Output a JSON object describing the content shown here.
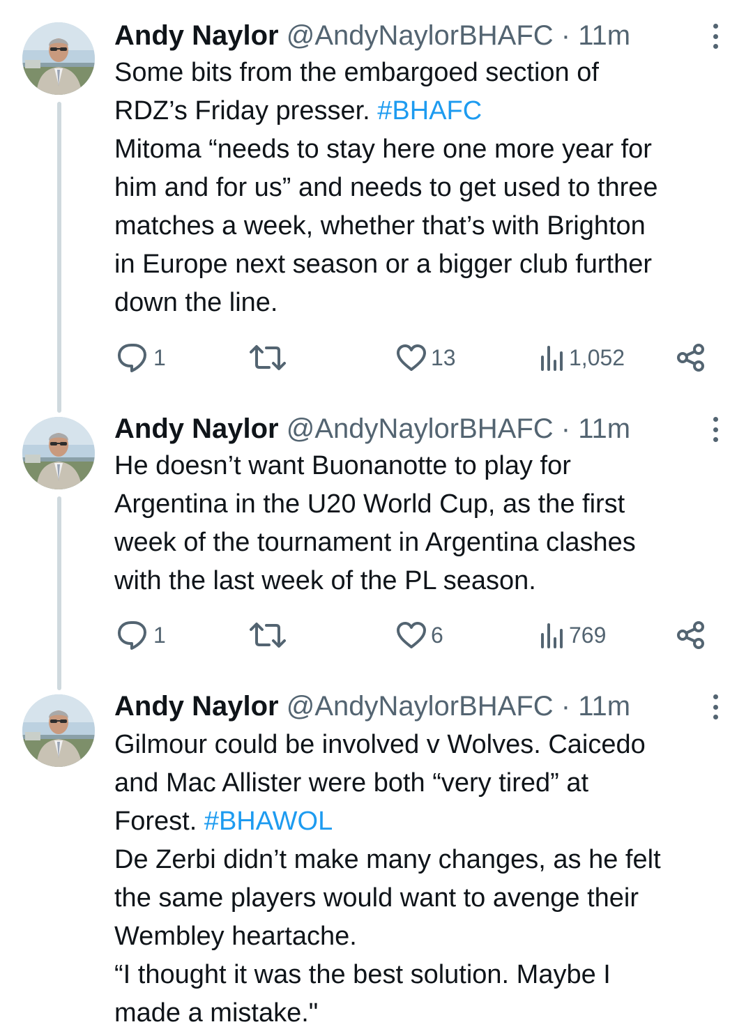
{
  "tweets": [
    {
      "author_name": "Andy Naylor",
      "handle": "@AndyNaylorBHAFC",
      "separator": "·",
      "time": "11m",
      "lines": [
        [
          {
            "text": "Some bits from the embargoed section of"
          }
        ],
        [
          {
            "text": "RDZ’s Friday presser. "
          },
          {
            "text": "#BHAFC",
            "hashtag": true
          }
        ],
        [
          {
            "text": "Mitoma “needs to stay here one more year for"
          }
        ],
        [
          {
            "text": "him and for us” and needs to get used to three"
          }
        ],
        [
          {
            "text": "matches a week, whether that’s with Brighton"
          }
        ],
        [
          {
            "text": "in Europe next season or a bigger club further"
          }
        ],
        [
          {
            "text": "down the line."
          }
        ]
      ],
      "replies": "1",
      "reposts": "",
      "likes": "13",
      "views": "1,052"
    },
    {
      "author_name": "Andy Naylor",
      "handle": "@AndyNaylorBHAFC",
      "separator": "·",
      "time": "11m",
      "lines": [
        [
          {
            "text": "He doesn’t want Buonanotte to play for"
          }
        ],
        [
          {
            "text": "Argentina in the U20 World Cup, as the first"
          }
        ],
        [
          {
            "text": "week of the tournament in Argentina clashes"
          }
        ],
        [
          {
            "text": "with the last week of the PL season."
          }
        ]
      ],
      "replies": "1",
      "reposts": "",
      "likes": "6",
      "views": "769"
    },
    {
      "author_name": "Andy Naylor",
      "handle": "@AndyNaylorBHAFC",
      "separator": "·",
      "time": "11m",
      "lines": [
        [
          {
            "text": "Gilmour could be involved v Wolves. Caicedo"
          }
        ],
        [
          {
            "text": "and Mac Allister were both “very tired” at"
          }
        ],
        [
          {
            "text": "Forest. "
          },
          {
            "text": "#BHAWOL",
            "hashtag": true
          }
        ],
        [
          {
            "text": "De Zerbi didn’t make many changes, as he felt"
          }
        ],
        [
          {
            "text": "the same players would want to avenge their"
          }
        ],
        [
          {
            "text": "Wembley heartache."
          }
        ],
        [
          {
            "text": "“I thought it was the best solution. Maybe I"
          }
        ],
        [
          {
            "text": "made a mistake.\""
          }
        ]
      ],
      "has_actions": false
    }
  ],
  "colors": {
    "text": "#0f1419",
    "secondary": "#536471",
    "hashtag": "#1d9bf0",
    "thread_line": "#cfd9de"
  },
  "icons": {
    "reply": "reply-icon",
    "repost": "repost-icon",
    "like": "heart-icon",
    "views": "views-chart-icon",
    "share": "share-icon",
    "more": "more-vertical-icon"
  }
}
